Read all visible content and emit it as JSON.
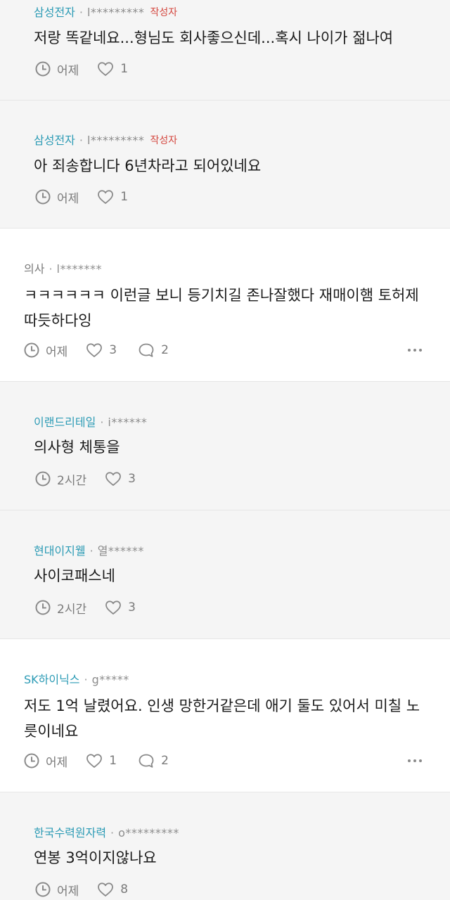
{
  "comments": [
    {
      "company": "삼성전자",
      "user": "l*********",
      "op_tag": "작성자",
      "text": "저랑 똑같네요...형님도 회사좋으신데...혹시 나이가 젊나여",
      "time": "어제",
      "likes": "1"
    },
    {
      "company": "삼성전자",
      "user": "l*********",
      "op_tag": "작성자",
      "text": "아 죄송합니다 6년차라고 되어있네요",
      "time": "어제",
      "likes": "1"
    },
    {
      "company": "의사",
      "user": "l*******",
      "text": "ㅋㅋㅋㅋㅋㅋ 이런글 보니 등기치길 존나잘했다 재매이햄 토허제\n따듯하다잉",
      "time": "어제",
      "likes": "3",
      "replies": "2"
    },
    {
      "company": "이랜드리테일",
      "user": "i******",
      "text": "의사형 체통을",
      "time": "2시간",
      "likes": "3"
    },
    {
      "company": "현대이지웰",
      "user": "열******",
      "text": "사이코패스네",
      "time": "2시간",
      "likes": "3"
    },
    {
      "company": "SK하이닉스",
      "user": "g*****",
      "text": "저도 1억 날렸어요. 인생 망한거같은데 애기 둘도 있어서 미칠 노\n릇이네요",
      "time": "어제",
      "likes": "1",
      "replies": "2"
    },
    {
      "company": "한국수력원자력",
      "user": "o*********",
      "text": "연봉 3억이지않나요",
      "time": "어제",
      "likes": "8"
    }
  ],
  "colors": {
    "company": "#2c9bb5",
    "op_tag": "#d4473f",
    "reply_bg": "#f5f5f5"
  },
  "icons": {
    "time": "clock-icon",
    "like": "heart-icon",
    "reply": "speech-bubble-icon",
    "more": "more-dots-icon"
  }
}
